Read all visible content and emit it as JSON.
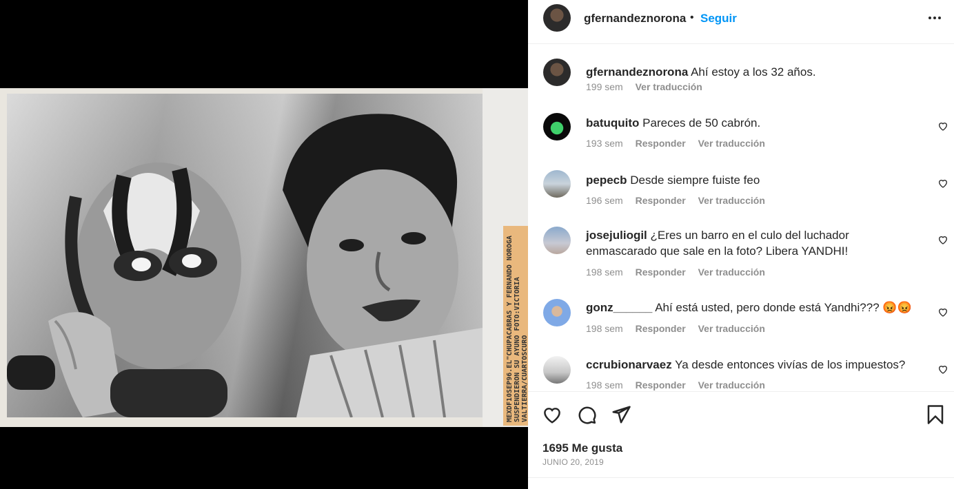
{
  "post": {
    "image_alt": "Black-and-white photo of a man speaking beside a masked wrestler",
    "stamp_text": "MEXDF10SEP96.EL\"CHUPACABRAS Y FERNANDO NOROGA SUSPENDIERON SU AYUNO FOTO:VICTORIA VALTIERRA/CUARTOSCURO"
  },
  "header": {
    "username": "gfernandeznorona",
    "separator": "•",
    "follow_label": "Seguir",
    "more_icon": "more-horizontal-icon"
  },
  "caption": {
    "user": "gfernandeznorona",
    "text": "Ahí estoy a los 32 años.",
    "time": "199 sem",
    "translate": "Ver traducción"
  },
  "comments": [
    {
      "user": "batuquito",
      "text": "Pareces de 50 cabrón.",
      "time": "193 sem",
      "reply": "Responder",
      "translate": "Ver traducción"
    },
    {
      "user": "pepecb",
      "text": "Desde siempre fuiste feo",
      "time": "196 sem",
      "reply": "Responder",
      "translate": "Ver traducción"
    },
    {
      "user": "josejuliogil",
      "text": "¿Eres un barro en el culo del luchador enmascarado que sale en la foto? Libera YANDHI!",
      "time": "198 sem",
      "reply": "Responder",
      "translate": "Ver traducción"
    },
    {
      "user": "gonz______",
      "text": "Ahí está usted, pero donde está Yandhi??? 😡😡",
      "time": "198 sem",
      "reply": "Responder",
      "translate": "Ver traducción"
    },
    {
      "user": "ccrubionarvaez",
      "text": "Ya desde entonces vivías de los impuestos?",
      "time": "198 sem",
      "reply": "Responder",
      "translate": "Ver traducción"
    }
  ],
  "footer": {
    "likes": "1695 Me gusta",
    "date": "JUNIO 20, 2019"
  }
}
